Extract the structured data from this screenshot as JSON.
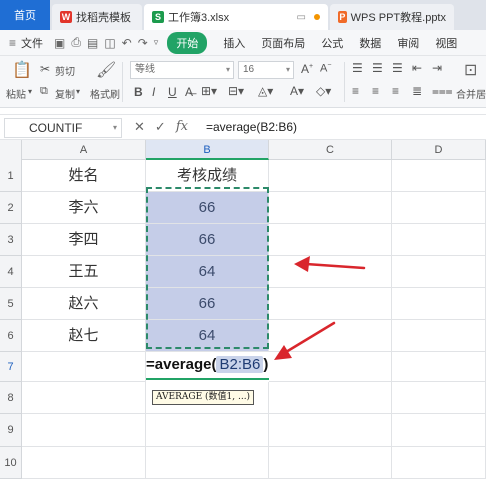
{
  "tabs": {
    "home": "首页",
    "template": "找稻壳模板",
    "workbook": "工作簿3.xlsx",
    "ppt": "WPS PPT教程.pptx"
  },
  "menu": {
    "file": "文件",
    "start": "开始",
    "insert": "插入",
    "page_layout": "页面布局",
    "formula": "公式",
    "data": "数据",
    "review": "审阅",
    "view": "视图"
  },
  "ribbon": {
    "paste": "粘贴",
    "cut": "剪切",
    "copy": "复制",
    "format_painter": "格式刷",
    "font_name": "等线",
    "font_size": "16",
    "merge": "合并居"
  },
  "formula_bar": {
    "name_box": "COUNTIF",
    "cancel_icon": "✕",
    "confirm_icon": "✓",
    "fx_icon": "fx",
    "content": "=average(B2:B6)"
  },
  "columns": [
    "A",
    "B",
    "C",
    "D"
  ],
  "rows": [
    "1",
    "2",
    "3",
    "4",
    "5",
    "6",
    "7",
    "8",
    "9",
    "10"
  ],
  "table": {
    "header_name": "姓名",
    "header_score": "考核成绩",
    "records": [
      {
        "name": "李六",
        "score": "66"
      },
      {
        "name": "李四",
        "score": "66"
      },
      {
        "name": "王五",
        "score": "64"
      },
      {
        "name": "赵六",
        "score": "66"
      },
      {
        "name": "赵七",
        "score": "64"
      }
    ]
  },
  "editing": {
    "prefix": "=average(",
    "range": "B2:B6",
    "suffix": ")",
    "tooltip": "AVERAGE (数值1, ...)"
  },
  "colors": {
    "accent_green": "#21a366",
    "home_tab_blue": "#1f6ed4",
    "selection_fill": "#c5cde8",
    "arrow_red": "#d9262c"
  }
}
